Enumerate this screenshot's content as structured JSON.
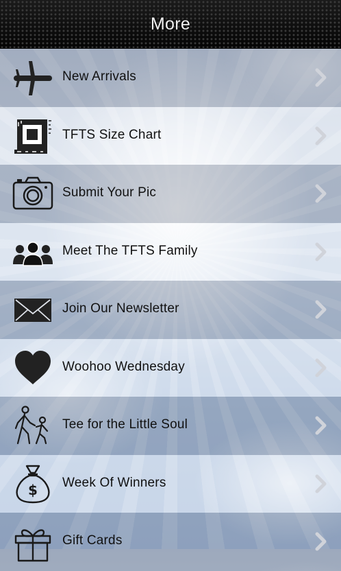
{
  "header": {
    "title": "More"
  },
  "menu": {
    "items": [
      {
        "label": "New Arrivals",
        "icon": "airplane-icon"
      },
      {
        "label": "TFTS Size Chart",
        "icon": "size-chart-icon"
      },
      {
        "label": "Submit Your Pic",
        "icon": "camera-icon"
      },
      {
        "label": "Meet The TFTS Family",
        "icon": "family-icon"
      },
      {
        "label": "Join Our Newsletter",
        "icon": "envelope-icon"
      },
      {
        "label": "Woohoo Wednesday",
        "icon": "heart-icon"
      },
      {
        "label": "Tee for the Little Soul",
        "icon": "walking-people-icon"
      },
      {
        "label": "Week Of Winners",
        "icon": "money-bag-icon"
      },
      {
        "label": "Gift Cards",
        "icon": "gift-icon"
      }
    ]
  },
  "colors": {
    "header_bg": "#111111",
    "header_text": "#f2f2f2",
    "label_text": "#111111",
    "chevron": "#d0d3da"
  }
}
